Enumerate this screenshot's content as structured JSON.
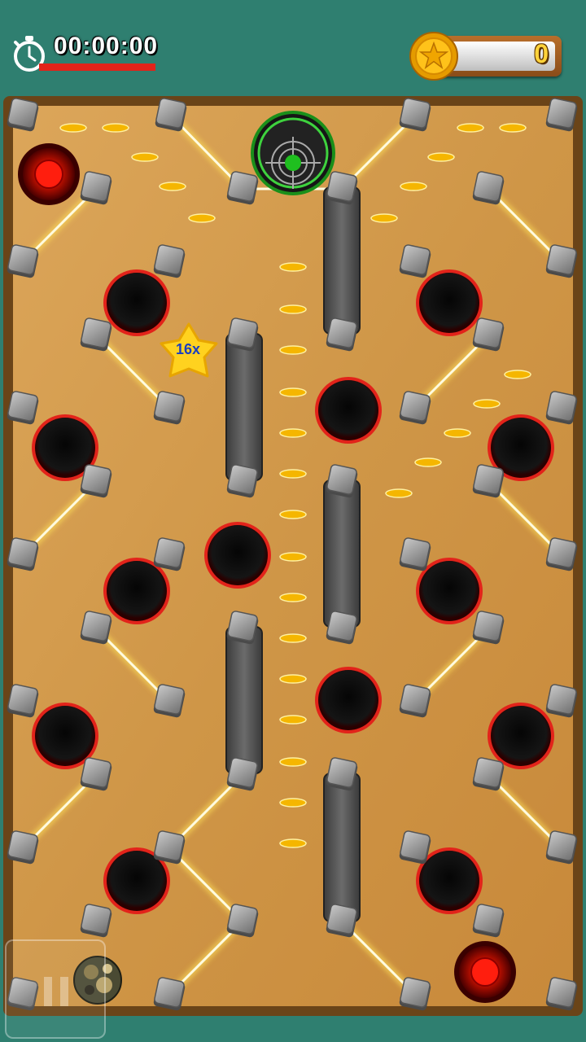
{
  "hud": {
    "timer": "00:00:00",
    "timer_icon": "stopwatch-icon",
    "coins": "0",
    "coin_icon": "star-coin-icon"
  },
  "board": {
    "multiplier": "16x",
    "multiplier_icon": "star-bonus-icon",
    "goal_icon": "target-goal-icon",
    "ball_icon": "camouflage-ball-icon",
    "pause_icon": "pause-icon"
  },
  "colors": {
    "background": "#2f7f70",
    "board_wood": "#d49a48",
    "hole_rim": "#e2231a",
    "laser": "#fff7b0",
    "coin": "#f5b600"
  }
}
